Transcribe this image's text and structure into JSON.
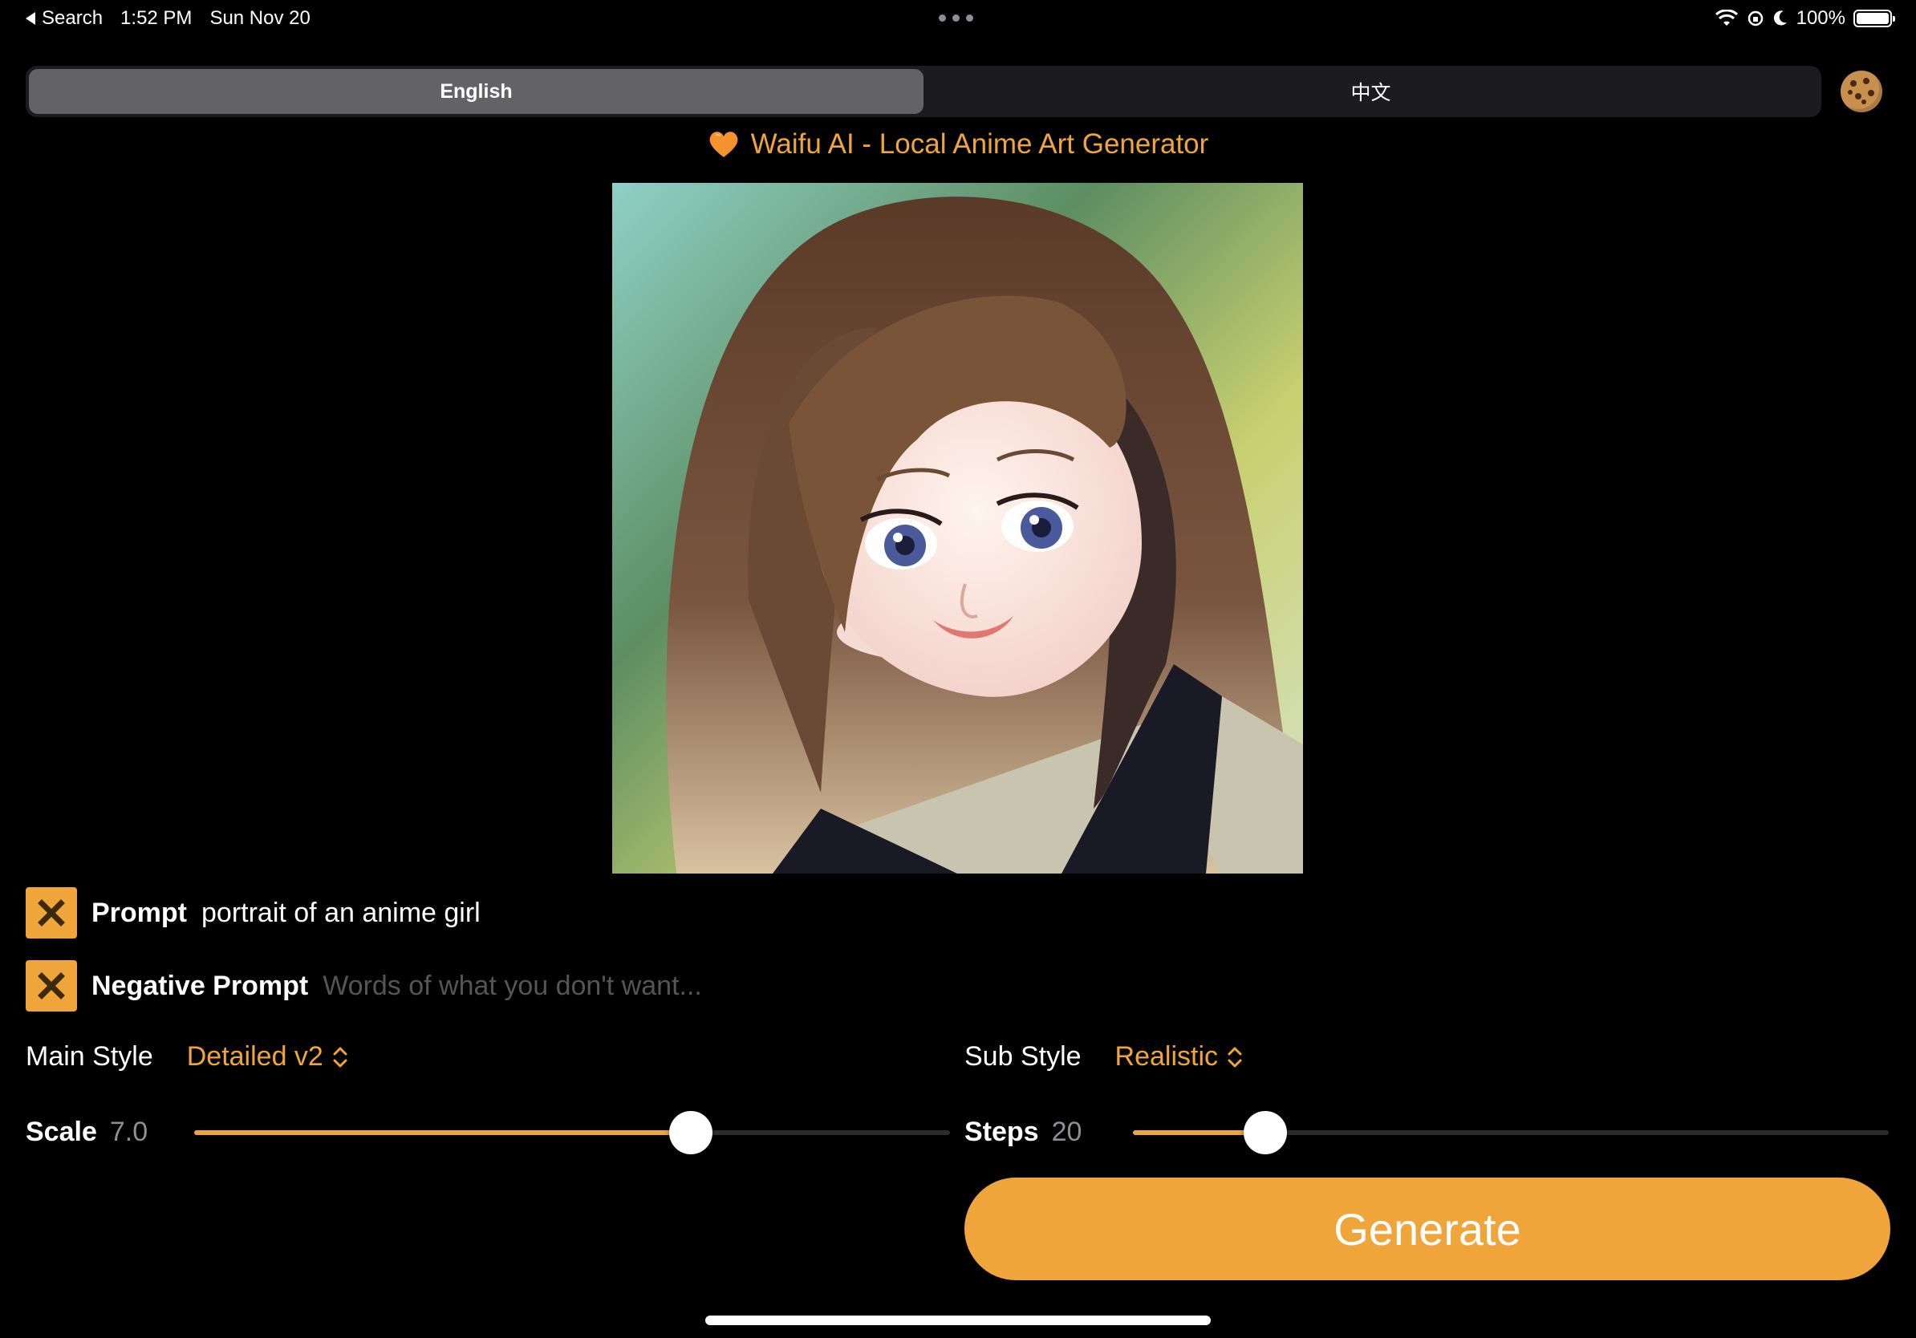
{
  "status_bar": {
    "back_label": "Search",
    "time": "1:52 PM",
    "date": "Sun Nov 20",
    "battery": "100%"
  },
  "language_tabs": [
    {
      "label": "English",
      "active": true
    },
    {
      "label": "中文",
      "active": false
    }
  ],
  "app_title": "Waifu AI - Local Anime Art Generator",
  "prompt": {
    "label": "Prompt",
    "value": "portrait of an anime girl"
  },
  "negative_prompt": {
    "label": "Negative Prompt",
    "placeholder": "Words of what you don't want..."
  },
  "main_style": {
    "label": "Main Style",
    "value": "Detailed v2"
  },
  "sub_style": {
    "label": "Sub Style",
    "value": "Realistic"
  },
  "scale": {
    "label": "Scale",
    "value": "7.0",
    "fraction": 0.657
  },
  "steps": {
    "label": "Steps",
    "value": "20",
    "fraction": 0.175
  },
  "generate_label": "Generate",
  "colors": {
    "accent": "#f0a53a",
    "background": "#000000",
    "segment_bg": "#1c1c1e",
    "segment_active": "#636366"
  }
}
